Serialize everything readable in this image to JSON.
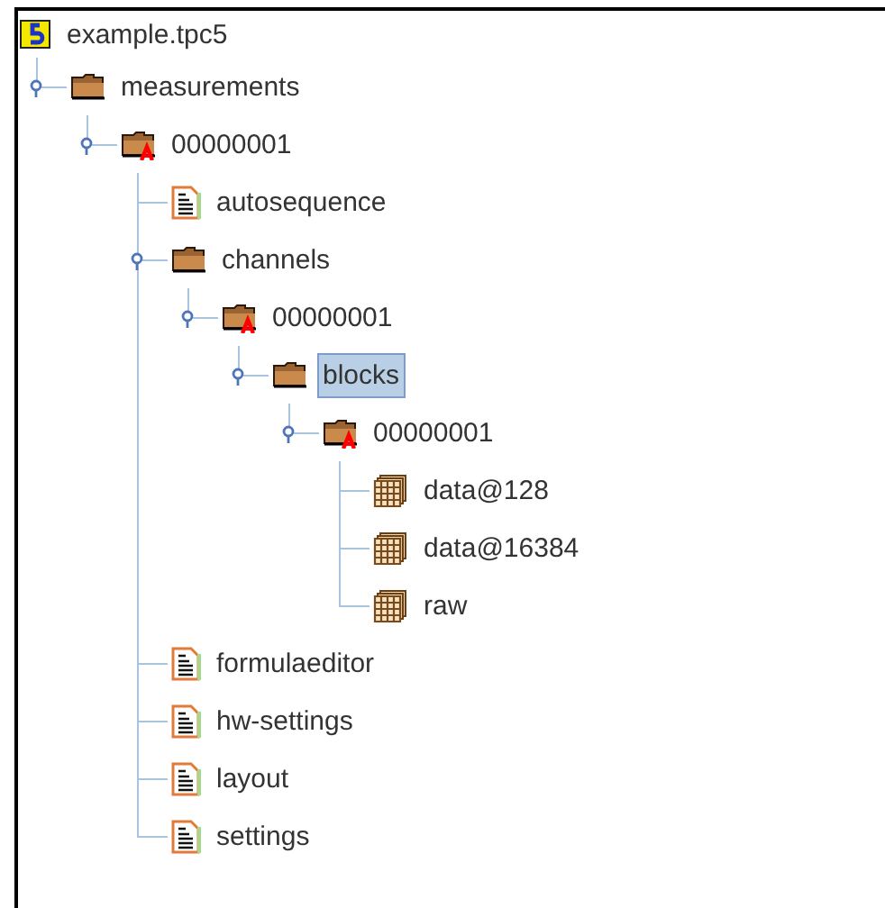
{
  "tree": {
    "label": "example.tpc5",
    "kind": "file",
    "selected": false,
    "children": [
      {
        "label": "measurements",
        "kind": "folder",
        "selected": false,
        "expanded": true,
        "children": [
          {
            "label": "00000001",
            "kind": "marked-folder",
            "selected": false,
            "expanded": true,
            "children": [
              {
                "label": "autosequence",
                "kind": "document",
                "selected": false
              },
              {
                "label": "channels",
                "kind": "folder",
                "selected": false,
                "expanded": true,
                "children": [
                  {
                    "label": "00000001",
                    "kind": "marked-folder",
                    "selected": false,
                    "expanded": true,
                    "children": [
                      {
                        "label": "blocks",
                        "kind": "folder",
                        "selected": true,
                        "expanded": true,
                        "children": [
                          {
                            "label": "00000001",
                            "kind": "marked-folder",
                            "selected": false,
                            "expanded": true,
                            "children": [
                              {
                                "label": "data@128",
                                "kind": "dataset",
                                "selected": false
                              },
                              {
                                "label": "data@16384",
                                "kind": "dataset",
                                "selected": false
                              },
                              {
                                "label": "raw",
                                "kind": "dataset",
                                "selected": false
                              }
                            ]
                          }
                        ]
                      }
                    ]
                  }
                ]
              },
              {
                "label": "formulaeditor",
                "kind": "document",
                "selected": false
              },
              {
                "label": "hw-settings",
                "kind": "document",
                "selected": false
              },
              {
                "label": "layout",
                "kind": "document",
                "selected": false
              },
              {
                "label": "settings",
                "kind": "document",
                "selected": false
              }
            ]
          }
        ]
      }
    ]
  }
}
